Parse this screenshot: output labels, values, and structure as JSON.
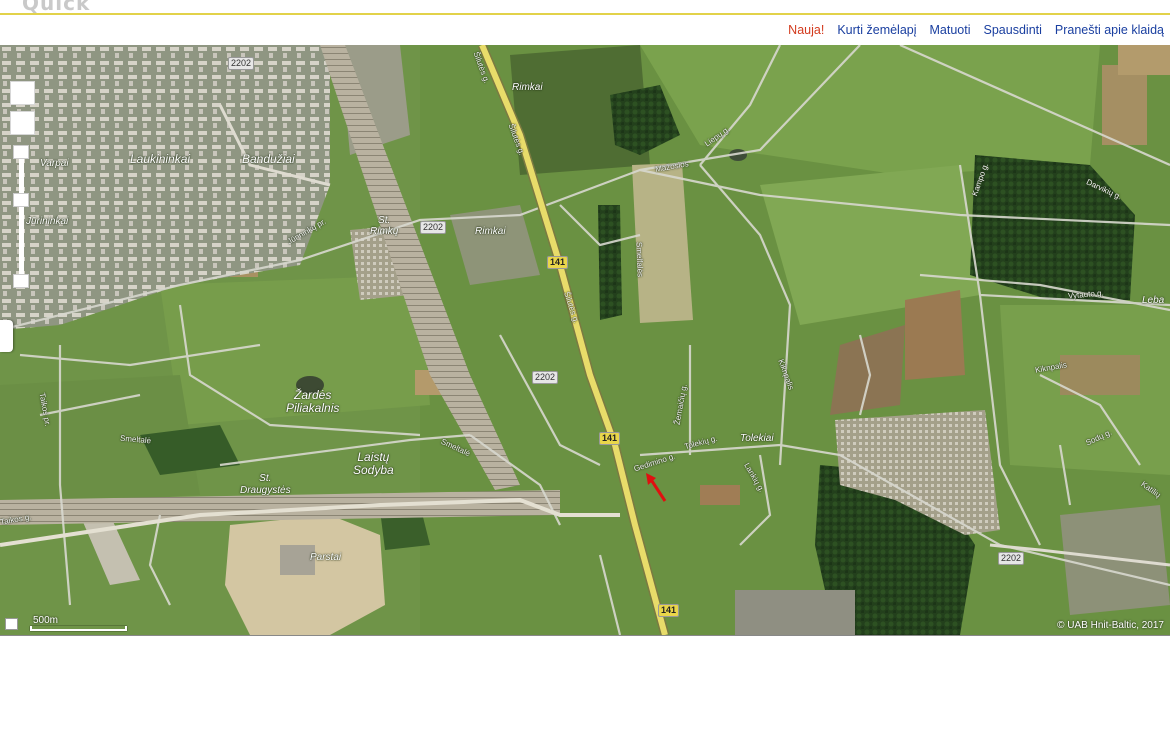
{
  "logo": "Quick",
  "menu": {
    "new": "Nauja!",
    "create_map": "Kurti žemėlapį",
    "measure": "Matuoti",
    "print": "Spausdinti",
    "report_error": "Pranešti apie klaidą"
  },
  "map": {
    "places": {
      "laukininkai": "Laukininkai",
      "banduziai": "Bandužiai",
      "varpai": "Varpai",
      "jurininkai": "Jūrininkai",
      "st_rimku": "St.\nRimkų",
      "rimkai_north": "Rimkai",
      "rimkai": "Rimkai",
      "zardes": "Žardės\nPiliakalnis",
      "laistu": "Laistų\nSodyba",
      "st_draugystes": "St.\nDraugystės",
      "tolekiai": "Tolekiai",
      "parstai": "Parstai",
      "leba": "Leba"
    },
    "streets": {
      "silutes_n": "Šilutės g.",
      "silutes_mid": "Šilutės g.",
      "silutes_s": "Šilutės g.",
      "mazosios": "Mažosios",
      "liepu": "Liepų g.",
      "smelfales": "Smelfalės",
      "smelfale": "Smeltalė",
      "smeltale2": "Smeltalė",
      "zemaitiu": "Žemaičių g.",
      "kiknpalis": "Kiknpalis",
      "kiknpalis2": "Kiknpalis",
      "gedimino": "Gedimino g.",
      "tolekiu": "Tolekių g.",
      "lankiu": "Lankių g.",
      "jurininku": "Jūrininkų pr.",
      "taikos": "Taikos pr.",
      "vytauto": "Vytauto g.",
      "kampo": "Kampo g.",
      "darvikiu": "Darvikių g.",
      "sodu": "Sodų g.",
      "katiliu": "Katilių",
      "taikos2": "Taikos g."
    },
    "road_numbers": {
      "r1": "2202",
      "r2": "2202",
      "r3": "2202",
      "r4": "2202",
      "a1": "141",
      "a2": "141",
      "a3": "141"
    },
    "scale_label": "500m",
    "copyright": "© UAB Hnit-Baltic, 2017"
  },
  "colors": {
    "menu_link": "#1a3fa0",
    "menu_new": "#d33a1d",
    "header_border": "#e2d24a",
    "highway": "#e8dc6a",
    "marker": "#e01010"
  }
}
